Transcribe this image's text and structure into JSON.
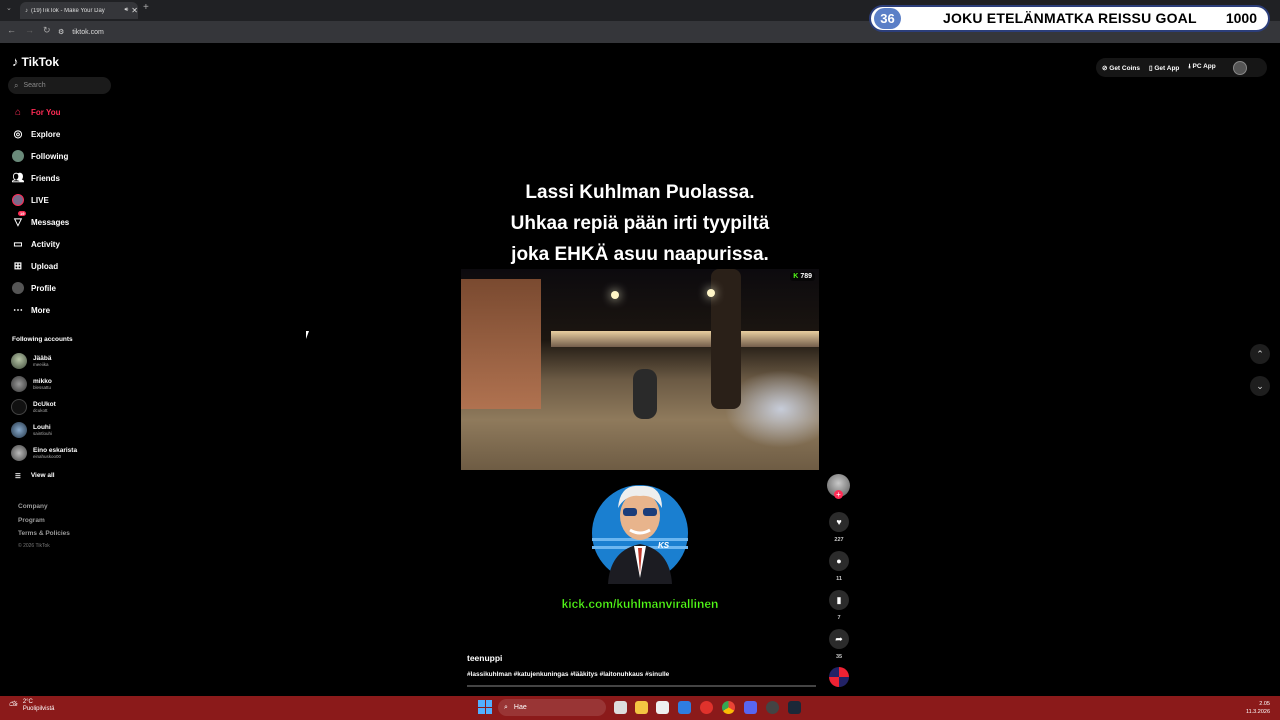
{
  "browser": {
    "tab_title": "(19)TikTok - Make Your Day",
    "url": "tiktok.com"
  },
  "goal_overlay": {
    "current": "36",
    "title": "JOKU ETELÄNMATKA REISSU GOAL",
    "target": "1000"
  },
  "sidebar": {
    "logo": "TikTok",
    "search_placeholder": "Search",
    "nav": [
      {
        "label": "For You",
        "icon": "home-icon"
      },
      {
        "label": "Explore",
        "icon": "compass-icon"
      },
      {
        "label": "Following",
        "icon": "following-avatar-icon"
      },
      {
        "label": "Friends",
        "icon": "friends-icon"
      },
      {
        "label": "LIVE",
        "icon": "live-icon"
      },
      {
        "label": "Messages",
        "icon": "messages-icon",
        "badge": "19"
      },
      {
        "label": "Activity",
        "icon": "activity-icon"
      },
      {
        "label": "Upload",
        "icon": "upload-icon"
      },
      {
        "label": "Profile",
        "icon": "profile-avatar-icon"
      },
      {
        "label": "More",
        "icon": "more-icon"
      }
    ],
    "following_title": "Following accounts",
    "accounts": [
      {
        "name": "Jääbä",
        "handle": "meeiika"
      },
      {
        "name": "mikko",
        "handle": "blessattu"
      },
      {
        "name": "DcUkot",
        "handle": "dcukott"
      },
      {
        "name": "Louhi",
        "handle": "saintlouhi"
      },
      {
        "name": "Eino eskarista",
        "handle": "einahuskoo00"
      }
    ],
    "view_all": "View all",
    "footer": [
      "Company",
      "Program",
      "Terms & Policies"
    ],
    "copyright": "© 2026 TikTok"
  },
  "topbar": {
    "get_coins": "Get Coins",
    "get_app": "Get App",
    "pc_app": "PC App"
  },
  "video": {
    "caption_lines": [
      "Lassi Kuhlman Puolassa.",
      "Uhkaa repiä pään irti tyypiltä",
      "joka EHKÄ asuu naapurissa."
    ],
    "viewer_badge": "789",
    "kick_link": "kick.com/kuhlmanvirallinen",
    "author": "teenuppi",
    "hashtags": "#lassikuhlman #katujenkuningas #lääkitys #laitonuhkaus #sinulle"
  },
  "actions": {
    "likes": "227",
    "comments": "11",
    "saves": "7",
    "shares": "35"
  },
  "taskbar": {
    "temp": "2°C",
    "weather": "Puolipilvistä",
    "search_placeholder": "Hae",
    "time": "2.05",
    "date": "11.3.2026"
  },
  "colors": {
    "accent": "#fe2c55",
    "kick_green": "#53fc18",
    "taskbar": "#8b1a1a"
  }
}
